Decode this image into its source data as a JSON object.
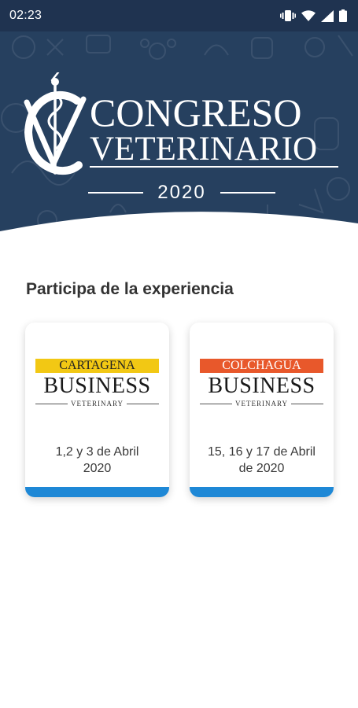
{
  "status_bar": {
    "time": "02:23"
  },
  "header": {
    "logo_line1": "CONGRESO",
    "logo_line2": "VETERINARIO",
    "year": "2020"
  },
  "section_title": "Participa de la experiencia",
  "events": [
    {
      "brand_tag": "CARTAGENA",
      "brand_main": "BUSINESS",
      "brand_sub": "VETERINARY",
      "date_line1": "1,2 y 3 de Abril",
      "date_line2": "2020",
      "tag_color": "#f2c814"
    },
    {
      "brand_tag": "COLCHAGUA",
      "brand_main": "BUSINESS",
      "brand_sub": "VETERINARY",
      "date_line1": "15, 16 y 17 de Abril",
      "date_line2": "de 2020",
      "tag_color": "#e8582b"
    }
  ],
  "colors": {
    "header_bg": "#26405f",
    "status_bar_bg": "#1f3350",
    "card_accent": "#1e88d6"
  }
}
